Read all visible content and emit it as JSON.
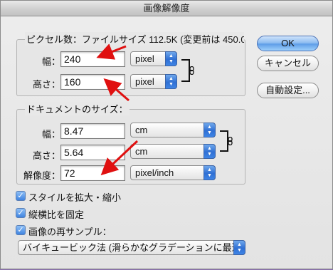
{
  "window": {
    "title": "画像解像度"
  },
  "pixel_dimensions": {
    "title": "ピクセル数：ファイルサイズ 112.5K (変更前は 450.0",
    "width": {
      "label": "幅：",
      "value": "240",
      "unit": "pixel"
    },
    "height": {
      "label": "高さ：",
      "value": "160",
      "unit": "pixel"
    }
  },
  "document_size": {
    "title": "ドキュメントのサイズ：",
    "width": {
      "label": "幅：",
      "value": "8.47",
      "unit": "cm"
    },
    "height": {
      "label": "高さ：",
      "value": "5.64",
      "unit": "cm"
    },
    "resolution": {
      "label": "解像度：",
      "value": "72",
      "unit": "pixel/inch"
    }
  },
  "buttons": {
    "ok": "OK",
    "cancel": "キャンセル",
    "auto": "自動設定..."
  },
  "checkboxes": {
    "scale_styles": {
      "label": "スタイルを拡大・縮小",
      "checked": true
    },
    "constrain": {
      "label": "縦横比を固定",
      "checked": true
    },
    "resample": {
      "label": "画像の再サンプル：",
      "checked": true
    }
  },
  "resample_method": "バイキュービック法 (滑らかなグラデーションに最適)",
  "colors": {
    "annotation_arrow": "#e01010",
    "accent": "#3f84e0"
  },
  "icons": {
    "check": "✓",
    "link": "chain-link-icon",
    "stepper": "▲▼"
  }
}
